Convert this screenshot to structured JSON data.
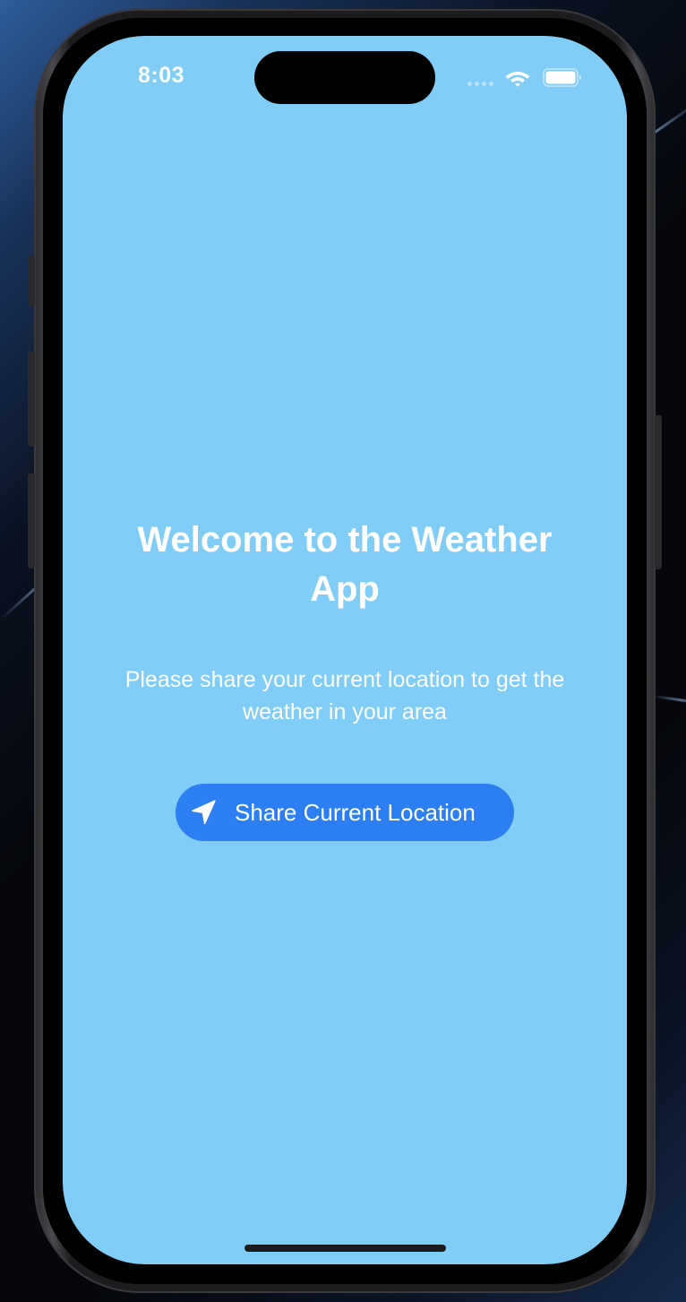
{
  "status_bar": {
    "time": "8:03",
    "icons": [
      "cellular-signal-icon",
      "wifi-icon",
      "battery-icon"
    ]
  },
  "welcome": {
    "title": "Welcome to the Weather App",
    "message": "Please share your current location to get the weather in your area"
  },
  "share_button": {
    "label": "Share Current Location",
    "icon": "location-arrow-icon"
  },
  "colors": {
    "background": "#80cdf8",
    "button": "#2b7ff2",
    "text": "#ffffff"
  }
}
